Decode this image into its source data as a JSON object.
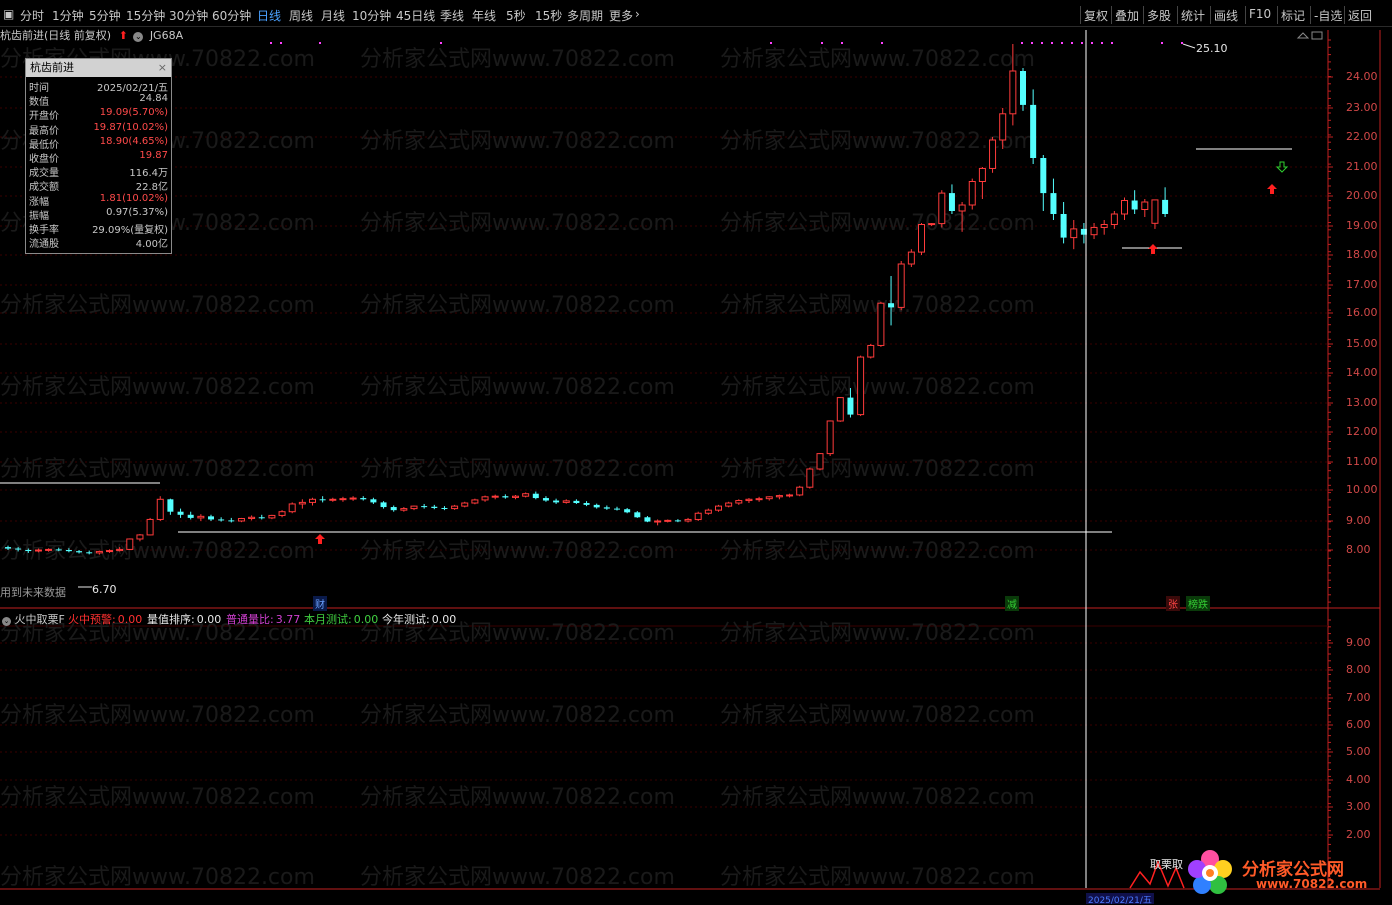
{
  "toolbar": {
    "period_tabs": [
      {
        "label": "分时"
      },
      {
        "label": "1分钟"
      },
      {
        "label": "5分钟"
      },
      {
        "label": "15分钟"
      },
      {
        "label": "30分钟"
      },
      {
        "label": "60分钟"
      },
      {
        "label": "日线",
        "active": true
      },
      {
        "label": "周线"
      },
      {
        "label": "月线"
      },
      {
        "label": "10分钟"
      },
      {
        "label": "45日线"
      },
      {
        "label": "季线"
      },
      {
        "label": "年线"
      },
      {
        "label": "5秒"
      },
      {
        "label": "15秒"
      },
      {
        "label": "多周期"
      },
      {
        "label": "更多"
      }
    ],
    "more_arrow": "›",
    "right_buttons": [
      {
        "label": "复权"
      },
      {
        "label": "叠加"
      },
      {
        "label": "多股"
      },
      {
        "label": "统计"
      },
      {
        "label": "画线"
      },
      {
        "label": "F10"
      },
      {
        "label": "标记"
      },
      {
        "label": "-自选"
      },
      {
        "label": "返回"
      }
    ]
  },
  "stock": {
    "title": "杭齿前进(日线 前复权)",
    "code": "JG68A",
    "arrow_color": "#ff2020"
  },
  "info_panel": {
    "title": "杭齿前进",
    "close": "×",
    "rows": [
      {
        "k": "时间",
        "v": "2025/02/21/五",
        "red": false
      },
      {
        "k": "数值",
        "v": "24.84",
        "red": false
      },
      {
        "k": "开盘价",
        "v": "19.09(5.70%)",
        "red": true
      },
      {
        "k": "最高价",
        "v": "19.87(10.02%)",
        "red": true
      },
      {
        "k": "最低价",
        "v": "18.90(4.65%)",
        "red": true
      },
      {
        "k": "收盘价",
        "v": "19.87",
        "red": true
      },
      {
        "k": "成交量",
        "v": "116.4万",
        "red": false
      },
      {
        "k": "成交额",
        "v": "22.8亿",
        "red": false
      },
      {
        "k": "涨幅",
        "v": "1.81(10.02%)",
        "red": true
      },
      {
        "k": "振幅",
        "v": "0.97(5.37%)",
        "red": false
      },
      {
        "k": "换手率",
        "v": "29.09%(量复权)",
        "red": false
      },
      {
        "k": "流通股",
        "v": "4.00亿",
        "red": false
      }
    ]
  },
  "price_axis": [
    "24.00",
    "23.00",
    "22.00",
    "21.00",
    "20.00",
    "19.00",
    "18.00",
    "17.00",
    "16.00",
    "15.00",
    "14.00",
    "13.00",
    "12.00",
    "11.00",
    "10.00",
    "9.00",
    "8.00"
  ],
  "indicator_axis": [
    "9.00",
    "8.00",
    "7.00",
    "6.00",
    "5.00",
    "4.00",
    "3.00",
    "2.00"
  ],
  "chart_labels": {
    "high_label": "25.10",
    "low_label": "6.70",
    "future_data": "用到未来数据"
  },
  "markers": [
    {
      "label": "财",
      "color": "#6aa0ff"
    },
    {
      "label": "减",
      "color": "#33cc33"
    },
    {
      "label": "张",
      "color": "#ff4444"
    },
    {
      "label": "榜跌",
      "color": "#33cc33"
    }
  ],
  "indicator": {
    "name": "火中取栗F",
    "items": [
      {
        "label": "火中预警:",
        "value": "0.00",
        "color": "#ff3030"
      },
      {
        "label": "量值排序:",
        "value": "0.00",
        "color": "#e8e8e8"
      },
      {
        "label": "普通量比:",
        "value": "3.77",
        "color": "#d040d0"
      },
      {
        "label": "本月测试:",
        "value": "0.00",
        "color": "#40d040"
      },
      {
        "label": "今年测试:",
        "value": "0.00",
        "color": "#e8e8e8"
      }
    ],
    "bottom_label": "取栗取"
  },
  "date_axis": {
    "cursor_date": "2025/02/21/五"
  },
  "logo": {
    "text": "分析家公式网",
    "url": "www.70822.com"
  },
  "watermark": "分析家公式网www.70822.com",
  "colors": {
    "up": "#ff3b3b",
    "down": "#54ffff",
    "axis": "#c02020",
    "grid": "#3a0000"
  },
  "chart_data": {
    "type": "candlestick",
    "ylim": [
      6.0,
      25.5
    ],
    "candles": [
      [
        8.1,
        8.15,
        8.0,
        8.05
      ],
      [
        8.05,
        8.1,
        7.95,
        8.02
      ],
      [
        8.0,
        8.05,
        7.9,
        7.98
      ],
      [
        7.98,
        8.05,
        7.92,
        8.0
      ],
      [
        8.0,
        8.06,
        7.94,
        8.02
      ],
      [
        8.02,
        8.08,
        7.96,
        8.0
      ],
      [
        8.0,
        8.06,
        7.92,
        7.96
      ],
      [
        7.96,
        8.0,
        7.88,
        7.92
      ],
      [
        7.92,
        7.98,
        7.85,
        7.9
      ],
      [
        7.9,
        7.98,
        7.84,
        7.95
      ],
      [
        7.95,
        8.02,
        7.9,
        7.98
      ],
      [
        7.98,
        8.1,
        7.95,
        8.02
      ],
      [
        8.02,
        8.4,
        8.0,
        8.38
      ],
      [
        8.38,
        8.55,
        8.3,
        8.52
      ],
      [
        8.52,
        9.1,
        8.5,
        9.05
      ],
      [
        9.05,
        9.8,
        9.0,
        9.7
      ],
      [
        9.7,
        9.72,
        9.2,
        9.3
      ],
      [
        9.3,
        9.4,
        9.1,
        9.2
      ],
      [
        9.2,
        9.3,
        9.05,
        9.1
      ],
      [
        9.1,
        9.22,
        9.0,
        9.15
      ],
      [
        9.15,
        9.2,
        9.0,
        9.05
      ],
      [
        9.05,
        9.12,
        8.98,
        9.02
      ],
      [
        9.02,
        9.1,
        8.95,
        9.0
      ],
      [
        9.0,
        9.1,
        8.96,
        9.08
      ],
      [
        9.08,
        9.18,
        9.02,
        9.12
      ],
      [
        9.12,
        9.2,
        9.05,
        9.1
      ],
      [
        9.1,
        9.2,
        9.06,
        9.18
      ],
      [
        9.18,
        9.35,
        9.12,
        9.3
      ],
      [
        9.3,
        9.6,
        9.25,
        9.55
      ],
      [
        9.55,
        9.7,
        9.4,
        9.6
      ],
      [
        9.6,
        9.75,
        9.5,
        9.7
      ],
      [
        9.7,
        9.8,
        9.6,
        9.68
      ],
      [
        9.68,
        9.75,
        9.62,
        9.7
      ],
      [
        9.7,
        9.78,
        9.62,
        9.72
      ],
      [
        9.72,
        9.8,
        9.65,
        9.74
      ],
      [
        9.74,
        9.8,
        9.66,
        9.7
      ],
      [
        9.7,
        9.75,
        9.55,
        9.6
      ],
      [
        9.6,
        9.64,
        9.4,
        9.45
      ],
      [
        9.45,
        9.5,
        9.3,
        9.35
      ],
      [
        9.35,
        9.45,
        9.3,
        9.4
      ],
      [
        9.4,
        9.5,
        9.35,
        9.48
      ],
      [
        9.48,
        9.55,
        9.4,
        9.46
      ],
      [
        9.46,
        9.52,
        9.38,
        9.42
      ],
      [
        9.42,
        9.48,
        9.35,
        9.4
      ],
      [
        9.4,
        9.52,
        9.36,
        9.48
      ],
      [
        9.48,
        9.62,
        9.44,
        9.58
      ],
      [
        9.58,
        9.72,
        9.54,
        9.68
      ],
      [
        9.68,
        9.82,
        9.62,
        9.78
      ],
      [
        9.78,
        9.85,
        9.7,
        9.8
      ],
      [
        9.8,
        9.86,
        9.72,
        9.76
      ],
      [
        9.76,
        9.84,
        9.7,
        9.8
      ],
      [
        9.8,
        9.92,
        9.76,
        9.88
      ],
      [
        9.88,
        9.95,
        9.7,
        9.74
      ],
      [
        9.74,
        9.8,
        9.62,
        9.66
      ],
      [
        9.66,
        9.72,
        9.55,
        9.6
      ],
      [
        9.6,
        9.7,
        9.56,
        9.65
      ],
      [
        9.65,
        9.7,
        9.55,
        9.58
      ],
      [
        9.58,
        9.64,
        9.48,
        9.52
      ],
      [
        9.52,
        9.56,
        9.4,
        9.44
      ],
      [
        9.44,
        9.5,
        9.36,
        9.4
      ],
      [
        9.4,
        9.46,
        9.34,
        9.38
      ],
      [
        9.38,
        9.42,
        9.25,
        9.28
      ],
      [
        9.28,
        9.32,
        9.1,
        9.12
      ],
      [
        9.12,
        9.16,
        8.96,
        8.98
      ],
      [
        8.98,
        9.05,
        8.85,
        9.0
      ],
      [
        9.0,
        9.05,
        8.95,
        9.02
      ],
      [
        9.02,
        9.06,
        8.96,
        9.0
      ],
      [
        9.0,
        9.1,
        8.95,
        9.05
      ],
      [
        9.05,
        9.3,
        9.0,
        9.25
      ],
      [
        9.25,
        9.4,
        9.2,
        9.35
      ],
      [
        9.35,
        9.52,
        9.3,
        9.48
      ],
      [
        9.48,
        9.62,
        9.44,
        9.58
      ],
      [
        9.58,
        9.7,
        9.52,
        9.66
      ],
      [
        9.66,
        9.74,
        9.58,
        9.7
      ],
      [
        9.7,
        9.78,
        9.62,
        9.72
      ],
      [
        9.72,
        9.8,
        9.66,
        9.78
      ],
      [
        9.78,
        9.85,
        9.7,
        9.82
      ],
      [
        9.82,
        9.88,
        9.76,
        9.84
      ],
      [
        9.84,
        10.15,
        9.8,
        10.1
      ],
      [
        10.1,
        10.8,
        10.05,
        10.75
      ],
      [
        10.75,
        11.3,
        10.7,
        11.28
      ],
      [
        11.28,
        12.4,
        11.2,
        12.38
      ],
      [
        12.38,
        13.2,
        12.35,
        13.18
      ],
      [
        13.18,
        13.5,
        12.5,
        12.6
      ],
      [
        12.6,
        14.6,
        12.55,
        14.55
      ],
      [
        14.55,
        15.0,
        14.5,
        14.95
      ],
      [
        14.95,
        16.4,
        14.9,
        16.35
      ],
      [
        16.35,
        17.3,
        15.6,
        16.2
      ],
      [
        16.2,
        17.8,
        16.1,
        17.7
      ],
      [
        17.7,
        18.2,
        17.6,
        18.1
      ],
      [
        18.1,
        19.1,
        18.0,
        19.05
      ],
      [
        19.05,
        19.1,
        19.0,
        19.08
      ],
      [
        19.08,
        20.2,
        18.95,
        20.1
      ],
      [
        20.1,
        20.4,
        19.4,
        19.5
      ],
      [
        19.5,
        19.8,
        18.8,
        19.7
      ],
      [
        19.7,
        20.6,
        19.55,
        20.5
      ],
      [
        20.5,
        21.0,
        19.9,
        20.95
      ],
      [
        20.95,
        22.0,
        20.8,
        21.9
      ],
      [
        21.9,
        23.0,
        21.6,
        22.8
      ],
      [
        22.8,
        25.1,
        22.4,
        24.2
      ],
      [
        24.2,
        24.3,
        22.9,
        23.1
      ],
      [
        23.1,
        23.6,
        21.1,
        21.3
      ],
      [
        21.3,
        21.4,
        19.5,
        20.1
      ],
      [
        20.1,
        20.6,
        19.2,
        19.4
      ],
      [
        19.4,
        19.8,
        18.4,
        18.6
      ],
      [
        18.6,
        19.2,
        18.2,
        18.9
      ],
      [
        18.9,
        19.1,
        18.4,
        18.7
      ],
      [
        18.7,
        19.1,
        18.55,
        18.95
      ],
      [
        18.95,
        19.2,
        18.7,
        19.05
      ],
      [
        19.05,
        19.5,
        18.9,
        19.4
      ],
      [
        19.4,
        19.95,
        19.2,
        19.85
      ],
      [
        19.85,
        20.2,
        19.4,
        19.55
      ],
      [
        19.55,
        19.9,
        19.3,
        19.8
      ],
      [
        19.09,
        19.87,
        18.9,
        19.87
      ],
      [
        19.87,
        20.3,
        19.3,
        19.4
      ]
    ]
  }
}
